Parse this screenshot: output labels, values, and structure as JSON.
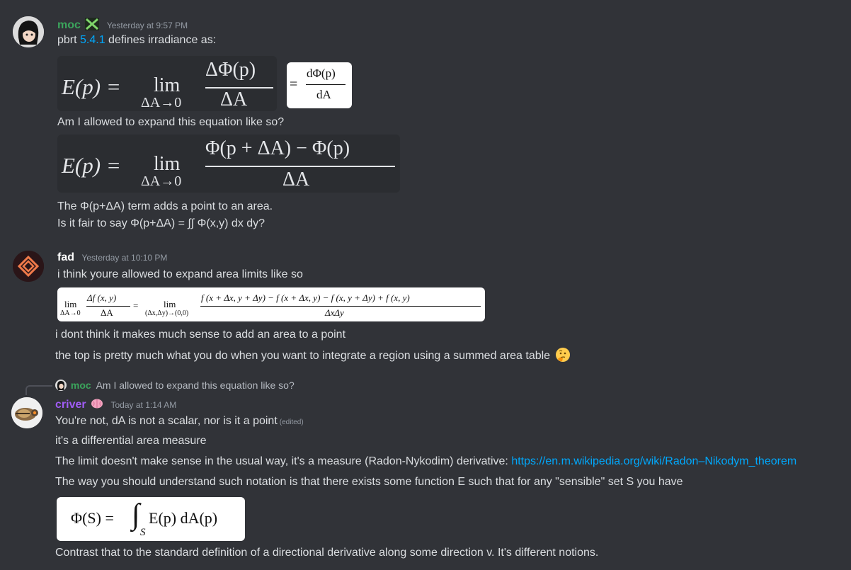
{
  "messages": {
    "moc": {
      "username": "moc",
      "timestamp": "Yesterday at 9:57 PM",
      "line1_prefix": "pbrt ",
      "line1_link": "5.4.1",
      "line1_suffix": " defines irradiance as:",
      "eq1": {
        "lhs": "E(p) =",
        "lim": "lim",
        "sub": "ΔA→0",
        "num": "ΔΦ(p)",
        "den": "ΔA",
        "eqsign": "=",
        "rnum": "dΦ(p)",
        "rden": "dA"
      },
      "line2": "Am I allowed to expand this equation like so?",
      "eq2": {
        "lhs": "E(p) =",
        "lim": "lim",
        "sub": "ΔA→0",
        "num": "Φ(p + ΔA) − Φ(p)",
        "den": "ΔA"
      },
      "line3": "The Φ(p+ΔA) term adds a point to an area.",
      "line4": "Is it fair to say Φ(p+ΔA) = ∫∫ Φ(x,y) dx dy?"
    },
    "fad": {
      "username": "fad",
      "timestamp": "Yesterday at 10:10 PM",
      "line1": "i think youre allowed to expand area limits like so",
      "eq": {
        "lim1": "lim",
        "sub1": "ΔA→0",
        "num1": "Δf (x, y)",
        "den1": "ΔA",
        "eqsign": "=",
        "lim2": "lim",
        "sub2": "(Δx,Δy)→(0,0)",
        "num2": "f (x + Δx, y + Δy) − f (x + Δx, y) − f (x, y + Δy) + f (x, y)",
        "den2": "ΔxΔy"
      },
      "line2": "i dont think it makes much sense to add an area to a point",
      "line3": "the top is pretty much what you do when you want to integrate a region using a summed area table",
      "emoji": "🤔"
    },
    "criver": {
      "reply_name": "moc",
      "reply_text": "Am I allowed to expand this equation like so?",
      "username": "criver",
      "timestamp": "Today at 1:14 AM",
      "line1": "You're not, dA is not a scalar, nor is it a point",
      "edited": "(edited)",
      "line2": "it's a differential area measure",
      "line3_prefix": "The limit doesn't make sense in the usual way, it's a measure (Radon-Nykodim) derivative: ",
      "line3_link": "https://en.m.wikipedia.org/wiki/Radon–Nikodym_theorem",
      "line4": "The way you should understand such notation is that there exists some function E such that for any \"sensible\" set S you have",
      "eq": {
        "lhs": "Φ(S) =",
        "integral": "∫",
        "sub": "S",
        "body": "E(p) dA(p)"
      },
      "line5": "Contrast that to the standard definition of a directional derivative along some direction v. It's different notions."
    }
  },
  "colors": {
    "background": "#313338",
    "text": "#dbdee1",
    "moc_name": "#3ba55c",
    "fad_name": "#ffffff",
    "criver_name": "#a05cf5",
    "link": "#00a8fc",
    "timestamp": "#949ba4"
  }
}
